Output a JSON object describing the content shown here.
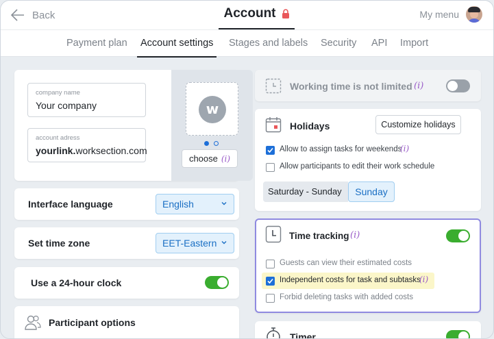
{
  "header": {
    "back_label": "Back",
    "title": "Account",
    "menu_label": "My menu"
  },
  "tabs": [
    {
      "label": "Payment plan",
      "active": false
    },
    {
      "label": "Account settings",
      "active": true
    },
    {
      "label": "Stages and labels",
      "active": false
    },
    {
      "label": "Security",
      "active": false
    },
    {
      "label": "API",
      "active": false
    },
    {
      "label": "Import",
      "active": false
    }
  ],
  "company": {
    "name_label": "company name",
    "name_value": "Your company",
    "address_label": "account adress",
    "address_prefix": "yourlink.",
    "address_suffix": "worksection.com",
    "logo_letter": "w",
    "choose_label": "choose",
    "info_mark": "(i)"
  },
  "interface_language": {
    "label": "Interface language",
    "value": "English"
  },
  "time_zone": {
    "label": "Set time zone",
    "value": "EET-Eastern"
  },
  "clock": {
    "label": "Use a 24-hour clock",
    "enabled": true
  },
  "participants": {
    "label": "Participant options"
  },
  "working_time": {
    "label": "Working time is not limited",
    "info": "(i)",
    "enabled": false
  },
  "holidays": {
    "title": "Holidays",
    "customize_label": "Customize holidays",
    "options": [
      {
        "label": "Allow to assign tasks for weekends",
        "info": "(i)",
        "checked": true
      },
      {
        "label": "Allow participants to edit their work schedule",
        "checked": false
      }
    ],
    "weekend_label": "Saturday - Sunday",
    "weekend_value": "Sunday"
  },
  "time_tracking": {
    "title": "Time tracking",
    "info": "(i)",
    "enabled": true,
    "options": [
      {
        "label": "Guests can view their estimated costs",
        "checked": false
      },
      {
        "label": "Independent costs for task and subtasks",
        "info": "(i)",
        "checked": true
      },
      {
        "label": "Forbid deleting tasks with added costs",
        "checked": false
      }
    ]
  },
  "timer": {
    "title": "Timer",
    "enabled": true
  },
  "colors": {
    "accent": "#1d6fd8",
    "toggle_on": "#3aad2f",
    "highlight": "#fbf6c9",
    "focus_border": "#8f8ae0"
  }
}
